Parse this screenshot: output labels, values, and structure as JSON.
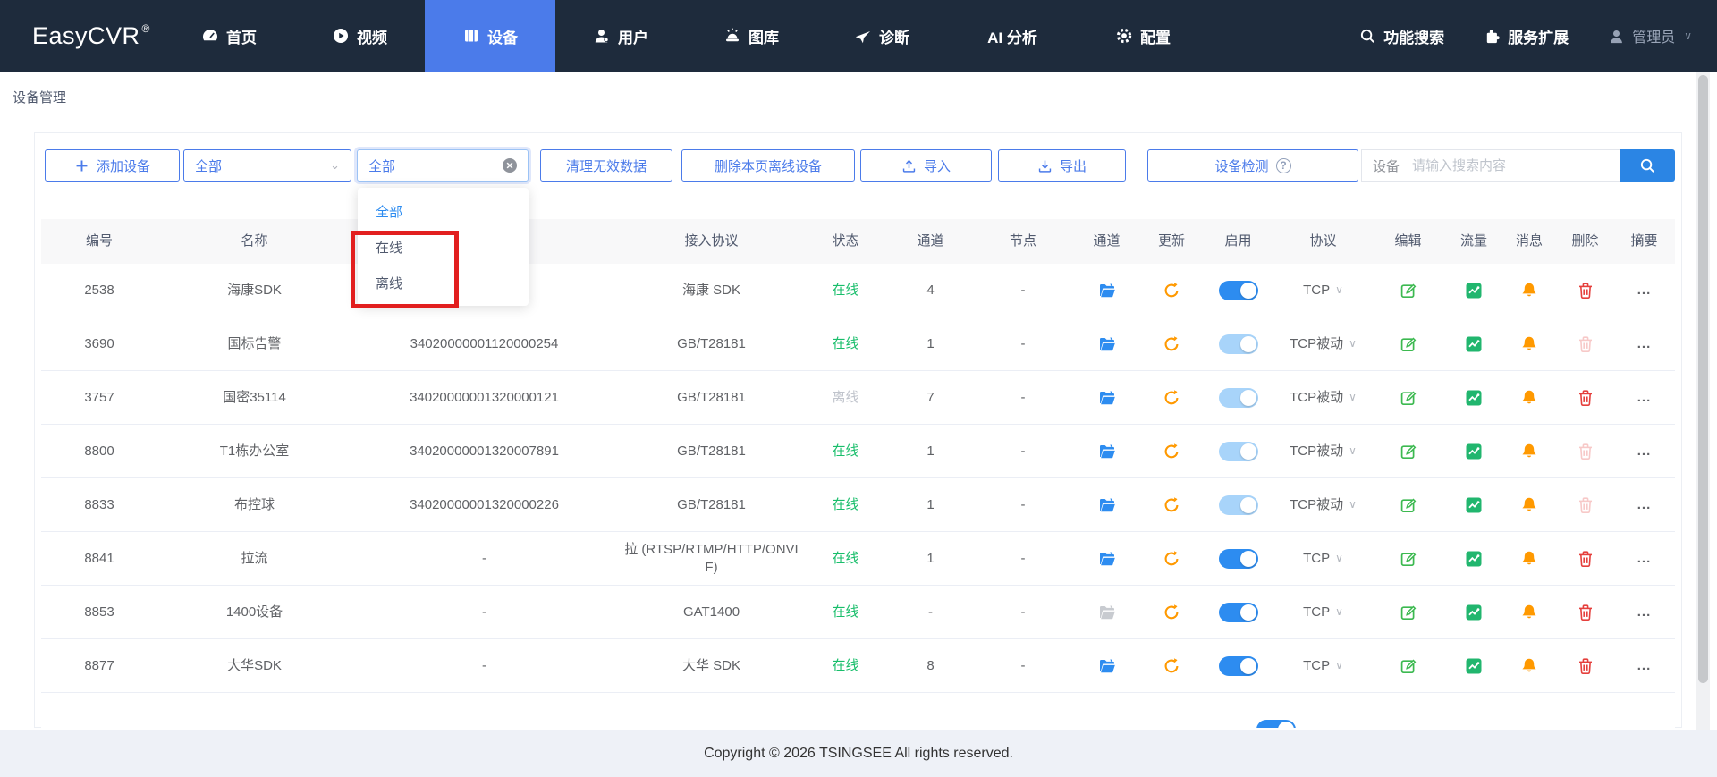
{
  "navbar": {
    "logo": "EasyCVR",
    "logo_mark": "®",
    "items": [
      {
        "label": "首页",
        "icon": "dashboard-icon",
        "active": false
      },
      {
        "label": "视频",
        "icon": "video-icon",
        "active": false
      },
      {
        "label": "设备",
        "icon": "device-icon",
        "active": true
      },
      {
        "label": "用户",
        "icon": "user-icon",
        "active": false
      },
      {
        "label": "图库",
        "icon": "gallery-icon",
        "active": false
      },
      {
        "label": "诊断",
        "icon": "diagnosis-icon",
        "active": false
      },
      {
        "label": "AI 分析",
        "icon": null,
        "active": false
      },
      {
        "label": "配置",
        "icon": "settings-icon",
        "active": false
      }
    ],
    "right": [
      {
        "label": "功能搜索",
        "icon": "search-icon",
        "admin": false,
        "chevron": false
      },
      {
        "label": "服务扩展",
        "icon": "extension-icon",
        "admin": false,
        "chevron": false
      },
      {
        "label": "管理员",
        "icon": "avatar-icon",
        "admin": true,
        "chevron": true
      }
    ]
  },
  "breadcrumb": "设备管理",
  "toolbar": {
    "add_label": "添加设备",
    "filter1_value": "全部",
    "filter2_value": "全部",
    "clean_label": "清理无效数据",
    "delete_offline_label": "删除本页离线设备",
    "import_label": "导入",
    "export_label": "导出",
    "detect_label": "设备检测",
    "detect_help": "?",
    "search_label": "设备",
    "search_placeholder": "请输入搜索内容"
  },
  "status_dropdown": {
    "options": [
      {
        "label": "全部",
        "selected": true
      },
      {
        "label": "在线",
        "selected": false
      },
      {
        "label": "离线",
        "selected": false
      }
    ]
  },
  "table": {
    "headers": [
      "编号",
      "名称",
      "",
      "接入协议",
      "状态",
      "通道",
      "节点",
      "通道",
      "更新",
      "启用",
      "协议",
      "编辑",
      "流量",
      "消息",
      "删除",
      "摘要"
    ],
    "more_label": "...",
    "rows": [
      {
        "num": "2538",
        "name": "海康SDK",
        "gb_id": "",
        "access": "海康 SDK",
        "status": "在线",
        "online": true,
        "channels": "4",
        "node": "-",
        "folder": "enabled",
        "toggle": "on",
        "transport": "TCP",
        "trash": "enabled"
      },
      {
        "num": "3690",
        "name": "国标告警",
        "gb_id": "34020000001120000254",
        "access": "GB/T28181",
        "status": "在线",
        "online": true,
        "channels": "1",
        "node": "-",
        "folder": "enabled",
        "toggle": "dim",
        "transport": "TCP被动",
        "trash": "disabled"
      },
      {
        "num": "3757",
        "name": "国密35114",
        "gb_id": "34020000001320000121",
        "access": "GB/T28181",
        "status": "离线",
        "online": false,
        "channels": "7",
        "node": "-",
        "folder": "enabled",
        "toggle": "dim",
        "transport": "TCP被动",
        "trash": "enabled"
      },
      {
        "num": "8800",
        "name": "T1栋办公室",
        "gb_id": "34020000001320007891",
        "access": "GB/T28181",
        "status": "在线",
        "online": true,
        "channels": "1",
        "node": "-",
        "folder": "enabled",
        "toggle": "dim",
        "transport": "TCP被动",
        "trash": "disabled"
      },
      {
        "num": "8833",
        "name": "布控球",
        "gb_id": "34020000001320000226",
        "access": "GB/T28181",
        "status": "在线",
        "online": true,
        "channels": "1",
        "node": "-",
        "folder": "enabled",
        "toggle": "dim",
        "transport": "TCP被动",
        "trash": "disabled"
      },
      {
        "num": "8841",
        "name": "拉流",
        "gb_id": "-",
        "access": "拉 (RTSP/RTMP/HTTP/ONVIF)",
        "status": "在线",
        "online": true,
        "channels": "1",
        "node": "-",
        "folder": "enabled",
        "toggle": "on",
        "transport": "TCP",
        "trash": "enabled"
      },
      {
        "num": "8853",
        "name": "1400设备",
        "gb_id": "-",
        "access": "GAT1400",
        "status": "在线",
        "online": true,
        "channels": "-",
        "node": "-",
        "folder": "disabled",
        "toggle": "on",
        "transport": "TCP",
        "trash": "enabled"
      },
      {
        "num": "8877",
        "name": "大华SDK",
        "gb_id": "-",
        "access": "大华 SDK",
        "status": "在线",
        "online": true,
        "channels": "8",
        "node": "-",
        "folder": "enabled",
        "toggle": "on",
        "transport": "TCP",
        "trash": "enabled"
      }
    ],
    "partial_row_toggle": "on"
  },
  "footer": {
    "copyright": "Copyright © 2026 TSINGSEE All rights reserved."
  },
  "colors": {
    "navbar_bg": "#1e2b3c",
    "nav_active": "#4b7bea",
    "toolbar_accent": "#4b7bea",
    "search_button": "#2b85e4",
    "toggle_on": "#2d8cf0",
    "toggle_dim": "#a8d4fa",
    "online_green": "#19be6b",
    "offline_gray": "#c0c4cc",
    "orange": "#ff9900",
    "red": "#e5403d",
    "annotation_red": "#e21f1f",
    "footer_bg": "#eef1f7"
  }
}
